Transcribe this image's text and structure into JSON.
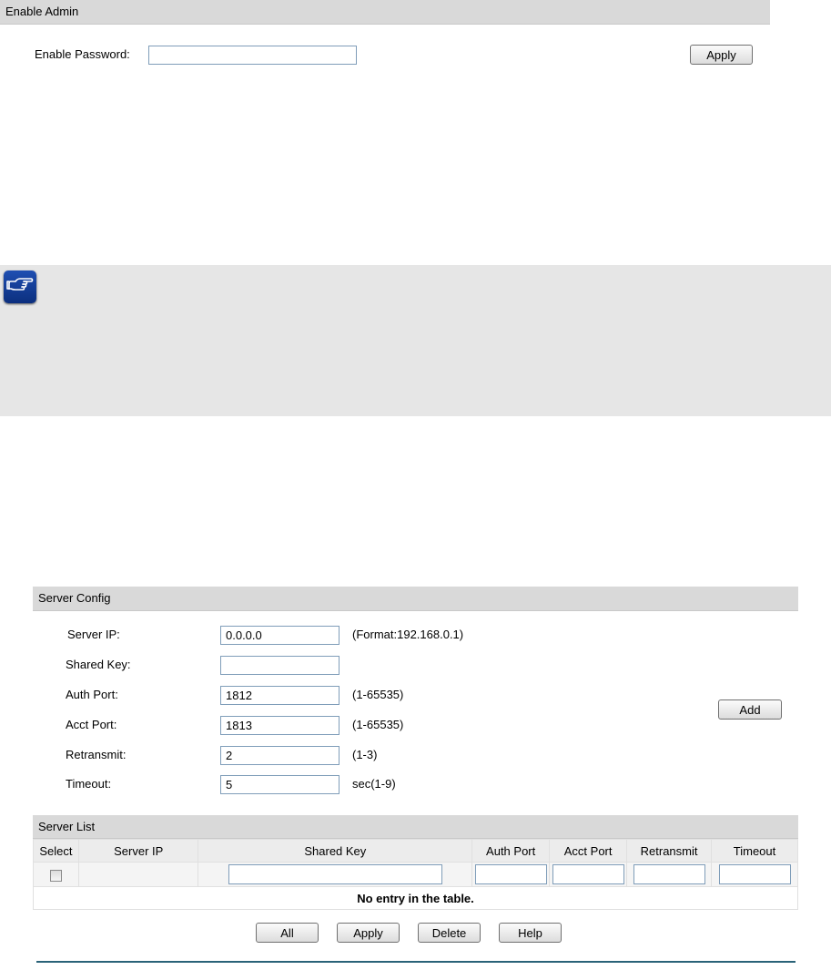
{
  "enable_admin": {
    "header": "Enable Admin",
    "password_label": "Enable Password:",
    "password_value": "",
    "apply_label": "Apply"
  },
  "note": {
    "icon": "pointing-hand-icon"
  },
  "server_config": {
    "header": "Server Config",
    "fields": {
      "server_ip": {
        "label": "Server IP:",
        "value": "0.0.0.0",
        "hint": "(Format:192.168.0.1)"
      },
      "shared_key": {
        "label": "Shared Key:",
        "value": ""
      },
      "auth_port": {
        "label": "Auth Port:",
        "value": "1812",
        "hint": "(1-65535)"
      },
      "acct_port": {
        "label": "Acct Port:",
        "value": "1813",
        "hint": "(1-65535)"
      },
      "retransmit": {
        "label": "Retransmit:",
        "value": "2",
        "hint": "(1-3)"
      },
      "timeout": {
        "label": "Timeout:",
        "value": "5",
        "hint": "sec(1-9)"
      }
    },
    "add_label": "Add"
  },
  "server_list": {
    "header": "Server List",
    "columns": [
      "Select",
      "Server IP",
      "Shared Key",
      "Auth Port",
      "Acct Port",
      "Retransmit",
      "Timeout"
    ],
    "empty_message": "No entry in the table.",
    "buttons": {
      "all": "All",
      "apply": "Apply",
      "delete": "Delete",
      "help": "Help"
    }
  },
  "colors": {
    "section_header_bg": "#d9d9d9",
    "note_bg": "#e6e6e6",
    "icon_blue": "#1f4fb2",
    "rule": "#2a6378"
  }
}
